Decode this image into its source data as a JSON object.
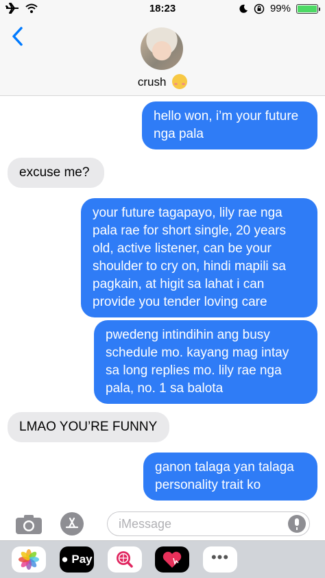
{
  "status_bar": {
    "time": "18:23",
    "battery": "99%",
    "battery_level": 0.99
  },
  "header": {
    "contact_name": "crush"
  },
  "messages": [
    {
      "direction": "sent",
      "text": "hello won, i’m your future\nnga pala"
    },
    {
      "direction": "received",
      "text": "excuse me?"
    },
    {
      "direction": "sent",
      "text": "your future tagapayo, lily rae nga\npala rae for short single, 20 years\nold, active listener, can be your\nshoulder to cry on, hindi mapili sa\npagkain, at higit sa lahat i can\nprovide you tender loving care"
    },
    {
      "direction": "sent",
      "text": "pwedeng intindihin ang busy\nschedule mo. kayang mag intay\nsa long replies mo. lily rae nga\npala, no. 1 sa balota"
    },
    {
      "direction": "received",
      "text": "LMAO YOU’RE FUNNY"
    },
    {
      "direction": "sent",
      "text": "ganon talaga yan talaga\npersonality trait ko"
    }
  ],
  "input": {
    "placeholder": "iMessage"
  },
  "app_drawer": {
    "apple_pay_label": "Pay",
    "more_label": "•••",
    "icons": [
      "photos-app-icon",
      "apple-pay-icon",
      "web-search-icon",
      "digital-touch-icon",
      "more-apps-icon"
    ]
  },
  "colors": {
    "sent_bubble": "#2f7cf6",
    "received_bubble": "#e9e9eb",
    "accent": "#007aff"
  }
}
